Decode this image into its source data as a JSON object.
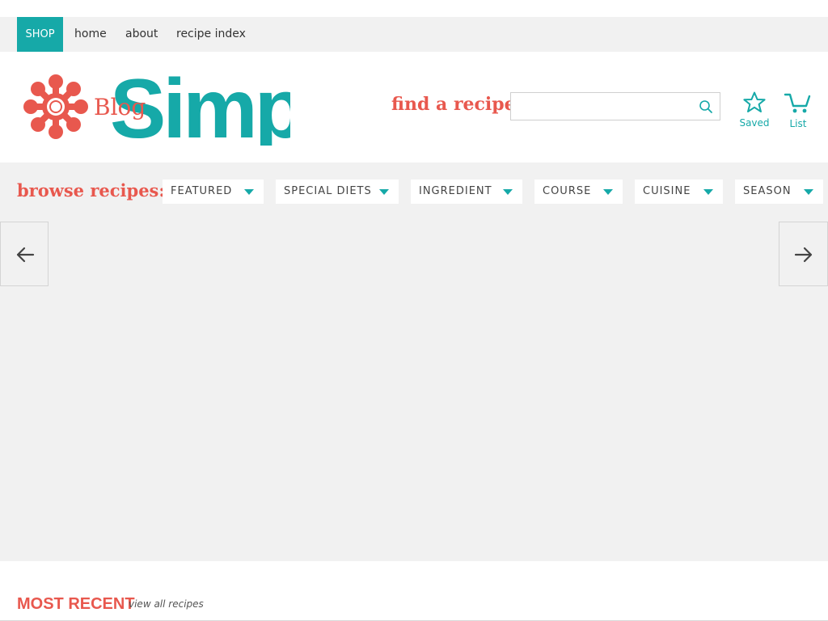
{
  "topnav": {
    "shop": "SHOP",
    "items": [
      "home",
      "about",
      "recipe index"
    ]
  },
  "logo": {
    "wordmark": "Simp",
    "alt_text": "Blog",
    "colors": {
      "flower": "#e8584e",
      "wordmark": "#16a9a8"
    }
  },
  "search": {
    "label": "find a recipe:",
    "value": "",
    "placeholder": ""
  },
  "header_buttons": {
    "saved": "Saved",
    "list": "List"
  },
  "browse": {
    "label": "browse recipes:",
    "dropdowns": [
      "FEATURED",
      "SPECIAL DIETS",
      "INGREDIENT",
      "COURSE",
      "CUISINE",
      "SEASON"
    ]
  },
  "section": {
    "title": "MOST RECENT",
    "link": "view all recipes"
  },
  "colors": {
    "accent_teal": "#16a9a8",
    "accent_coral": "#e8584e",
    "panel_gray": "#f1f1f1"
  }
}
